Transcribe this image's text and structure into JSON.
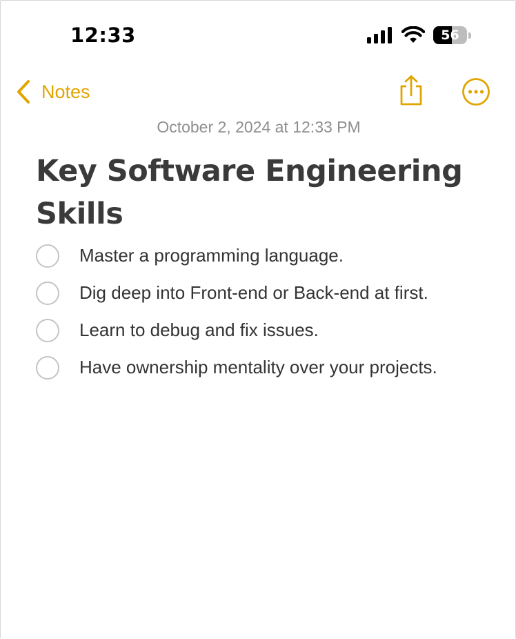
{
  "status_bar": {
    "time": "12:33",
    "battery_level": "56",
    "battery_fraction": 0.56,
    "icons": [
      "signal-icon",
      "wifi-icon",
      "battery-icon"
    ]
  },
  "nav": {
    "back_label": "Notes",
    "accent_color": "#e1a500",
    "icons": [
      "chevron-left-icon",
      "share-icon",
      "more-icon"
    ]
  },
  "note": {
    "date": "October 2, 2024 at 12:33 PM",
    "title": "Key Software Engineering Skills",
    "checklist": [
      {
        "text": "Master a programming language.",
        "checked": false
      },
      {
        "text": "Dig deep into Front-end or Back-end at first.",
        "checked": false
      },
      {
        "text": "Learn to debug and fix issues.",
        "checked": false
      },
      {
        "text": "Have ownership mentality over your projects.",
        "checked": false
      }
    ]
  }
}
